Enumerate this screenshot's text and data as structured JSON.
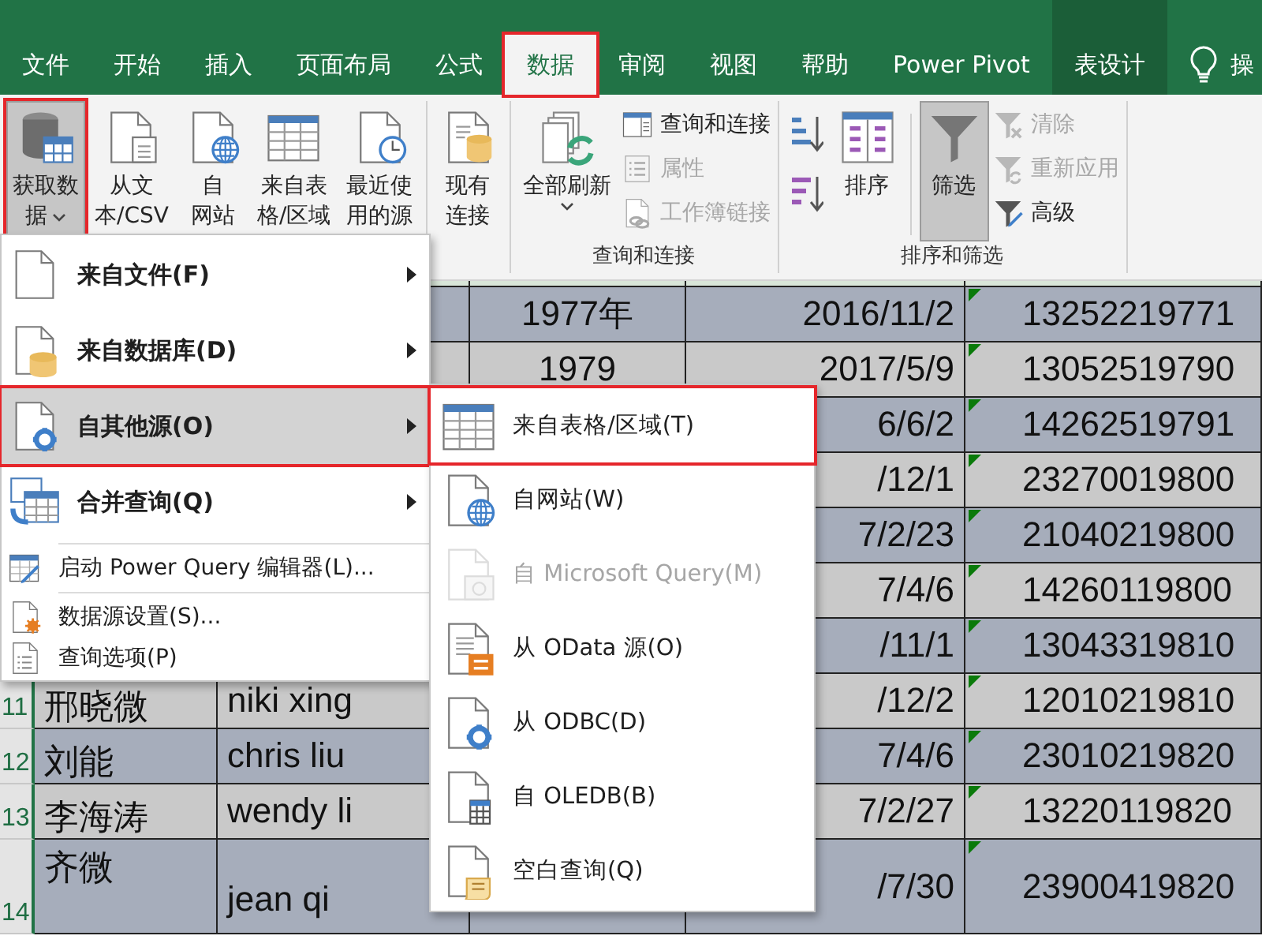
{
  "ribbon_tabs": [
    {
      "label": "文件",
      "kind": "normal",
      "selected": false,
      "highlighted": false
    },
    {
      "label": "开始",
      "kind": "normal",
      "selected": false,
      "highlighted": false
    },
    {
      "label": "插入",
      "kind": "normal",
      "selected": false,
      "highlighted": false
    },
    {
      "label": "页面布局",
      "kind": "normal",
      "selected": false,
      "highlighted": false
    },
    {
      "label": "公式",
      "kind": "normal",
      "selected": false,
      "highlighted": false
    },
    {
      "label": "数据",
      "kind": "normal",
      "selected": true,
      "highlighted": true
    },
    {
      "label": "审阅",
      "kind": "normal",
      "selected": false,
      "highlighted": false
    },
    {
      "label": "视图",
      "kind": "normal",
      "selected": false,
      "highlighted": false
    },
    {
      "label": "帮助",
      "kind": "normal",
      "selected": false,
      "highlighted": false
    },
    {
      "label": "Power Pivot",
      "kind": "normal",
      "selected": false,
      "highlighted": false
    },
    {
      "label": "表设计",
      "kind": "contextual",
      "selected": false,
      "highlighted": false
    }
  ],
  "tell_me": "操",
  "ribbon": {
    "groups": [
      {
        "kind": "get-data",
        "buttons": [
          {
            "lines": [
              "获取数",
              "据"
            ],
            "dropdown": true,
            "pressed": true,
            "highlighted": true
          },
          {
            "lines": [
              "从文",
              "本/CSV"
            ],
            "dropdown": false,
            "pressed": false,
            "highlighted": false
          },
          {
            "lines": [
              "自",
              "网站"
            ],
            "dropdown": false,
            "pressed": false,
            "highlighted": false
          },
          {
            "lines": [
              "来自表",
              "格/区域"
            ],
            "dropdown": false,
            "pressed": false,
            "highlighted": false
          },
          {
            "lines": [
              "最近使",
              "用的源"
            ],
            "dropdown": false,
            "pressed": false,
            "highlighted": false
          }
        ]
      },
      {
        "kind": "connections",
        "buttons": [
          {
            "lines": [
              "现有",
              "连接"
            ],
            "dropdown": false,
            "pressed": false
          }
        ]
      },
      {
        "kind": "queries",
        "label": "查询和连接",
        "buttons": [
          {
            "lines": [
              "全部刷新"
            ],
            "dropdown": true,
            "pressed": false
          }
        ],
        "small_buttons": [
          {
            "label": "查询和连接",
            "disabled": false
          },
          {
            "label": "属性",
            "disabled": true
          },
          {
            "label": "工作簿链接",
            "disabled": true
          }
        ]
      },
      {
        "kind": "sort-filter",
        "label": "排序和筛选",
        "buttons": [
          {
            "lines": [
              "排序"
            ],
            "dropdown": false,
            "pressed": false
          },
          {
            "lines": [
              "筛选"
            ],
            "dropdown": false,
            "pressed": true
          }
        ],
        "small_buttons": [
          {
            "label": "清除",
            "disabled": true
          },
          {
            "label": "重新应用",
            "disabled": true
          },
          {
            "label": "高级",
            "disabled": false
          }
        ]
      }
    ]
  },
  "sheet": {
    "rows": [
      {
        "column_3": "1977年",
        "column_4": "2016/11/2",
        "column_5": "13252219771"
      },
      {
        "column_3": "1979",
        "column_4": "2017/5/9",
        "column_5": "13052519790"
      },
      {
        "column_4": "6/6/2",
        "column_5": "14262519791"
      },
      {
        "column_4": "/12/1",
        "column_5": "23270019800"
      },
      {
        "column_4": "7/2/23",
        "column_5": "21040219800"
      },
      {
        "column_4": "7/4/6",
        "column_5": "14260119800"
      },
      {
        "column_4": "/11/1",
        "column_5": "13043319810"
      },
      {
        "number": "11",
        "column_1": "邢晓微",
        "column_2": "niki xing",
        "column_4": "/12/2",
        "column_5": "12010219810"
      },
      {
        "number": "12",
        "column_1": "刘能",
        "column_2": "chris liu",
        "column_4": "7/4/6",
        "column_5": "23010219820"
      },
      {
        "number": "13",
        "column_1": "李海涛",
        "column_2": "wendy li",
        "column_4": "7/2/27",
        "column_5": "13220119820"
      },
      {
        "number": "14",
        "column_1": "齐微",
        "column_2": "jean qi",
        "column_4": "/7/30",
        "column_5": "23900419820"
      }
    ]
  },
  "get_data_menu": {
    "items": [
      {
        "kind": "submenu",
        "label": "来自文件(F)",
        "separator_before": false,
        "selected": false,
        "highlighted": false
      },
      {
        "kind": "submenu",
        "label": "来自数据库(D)",
        "separator_before": false,
        "selected": false,
        "highlighted": false
      },
      {
        "kind": "submenu",
        "label": "自其他源(O)",
        "separator_before": false,
        "selected": true,
        "highlighted": true
      },
      {
        "kind": "submenu",
        "label": "合并查询(Q)",
        "separator_before": false,
        "selected": false,
        "highlighted": false
      },
      {
        "kind": "command",
        "label": "启动 Power Query 编辑器(L)...",
        "separator_before": true,
        "selected": false,
        "highlighted": false
      },
      {
        "kind": "command",
        "label": "数据源设置(S)...",
        "separator_before": true,
        "selected": false,
        "highlighted": false
      },
      {
        "kind": "command",
        "label": "查询选项(P)",
        "separator_before": false,
        "selected": false,
        "highlighted": false
      }
    ]
  },
  "other_sources_submenu": {
    "items": [
      {
        "label": "来自表格/区域(T)",
        "disabled": false,
        "highlighted": true
      },
      {
        "label": "自网站(W)",
        "disabled": false,
        "highlighted": false
      },
      {
        "label": "自 Microsoft Query(M)",
        "disabled": true,
        "highlighted": false
      },
      {
        "label": "从 OData 源(O)",
        "disabled": false,
        "highlighted": false
      },
      {
        "label": "从 ODBC(D)",
        "disabled": false,
        "highlighted": false
      },
      {
        "label": "自 OLEDB(B)",
        "disabled": false,
        "highlighted": false
      },
      {
        "label": "空白查询(Q)",
        "disabled": false,
        "highlighted": false
      }
    ]
  }
}
